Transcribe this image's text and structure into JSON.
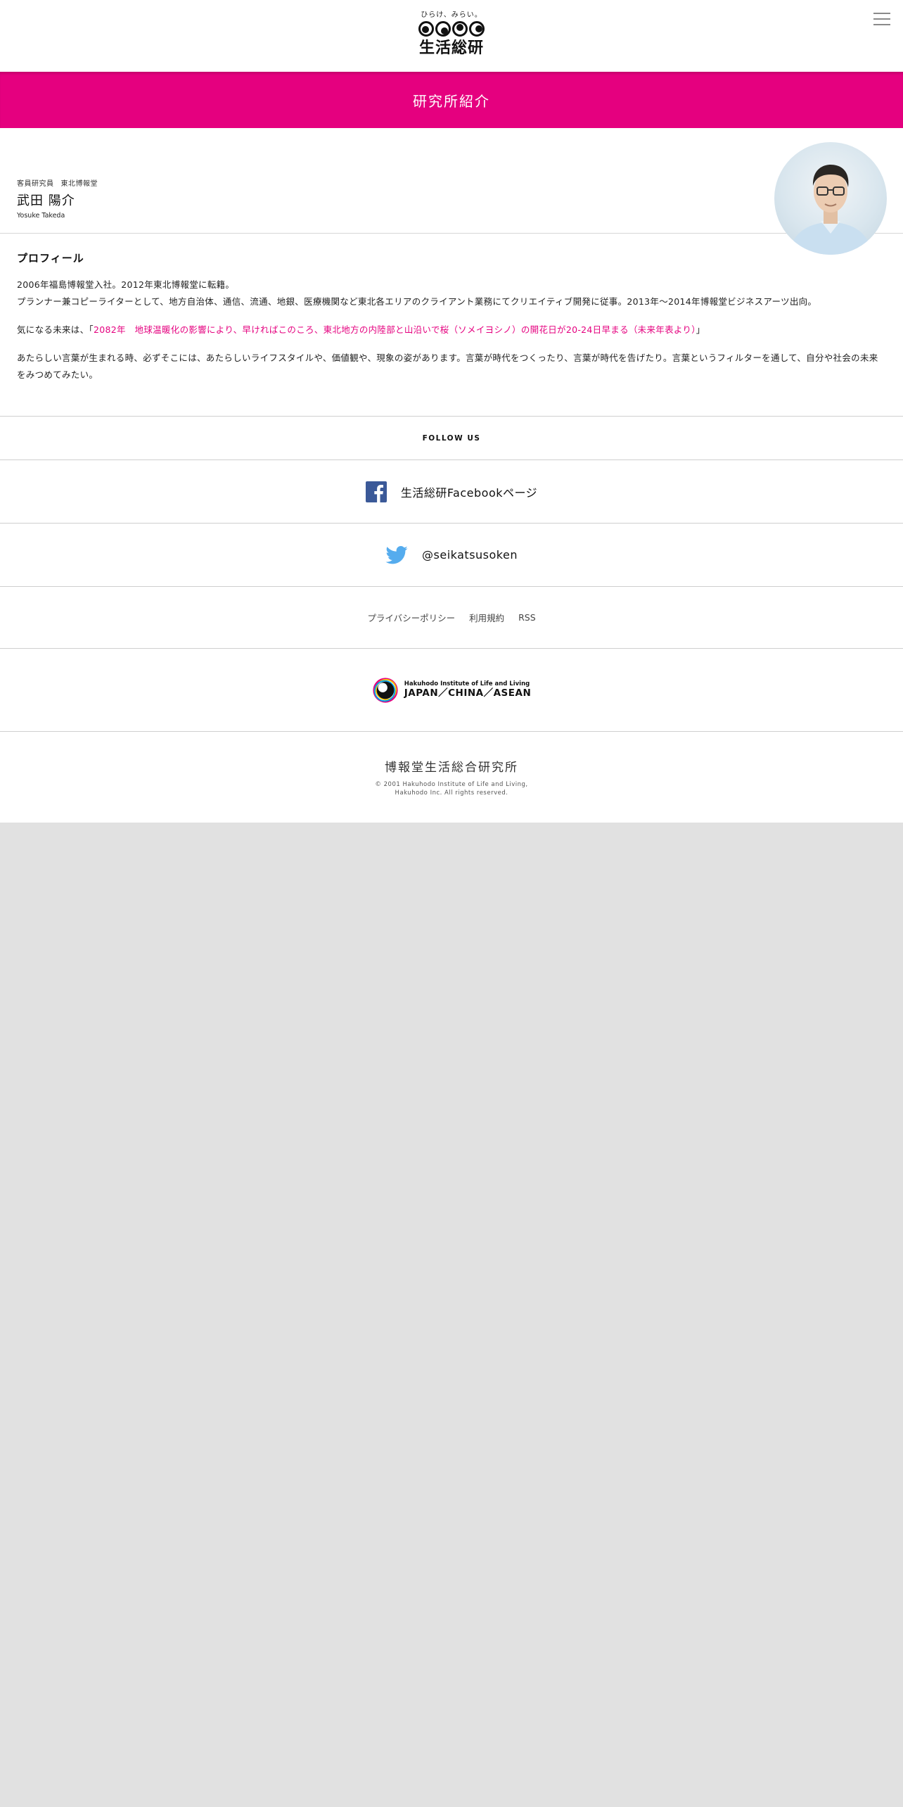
{
  "header": {
    "logo_tagline": "ひらけ、みらい。",
    "logo_name": "生活総研"
  },
  "title_bar": {
    "title": "研究所紹介"
  },
  "profile": {
    "role": "客員研究員",
    "affiliation": "東北博報堂",
    "name": "武田 陽介",
    "romaji": "Yosuke Takeda",
    "section_heading": "プロフィール",
    "bio_line1": "2006年福島博報堂入社。2012年東北博報堂に転籍。",
    "bio_line2": "プランナー兼コピーライターとして、地方自治体、通信、流通、地銀、医療機関など東北各エリアのクライアント業務にてクリエイティブ開発に従事。2013年～2014年博報堂ビジネスアーツ出向。",
    "future_prefix": "気になる未来は、「",
    "future_link": "2082年　地球温暖化の影響により、早ければこのころ、東北地方の内陸部と山沿いで桜（ソメイヨシノ）の開花日が20-24日早まる（未来年表より）",
    "future_suffix": "」",
    "closing": "あたらしい言葉が生まれる時、必ずそこには、あたらしいライフスタイルや、価値観や、現象の姿があります。言葉が時代をつくったり、言葉が時代を告げたり。言葉というフィルターを通して、自分や社会の未来をみつめてみたい。"
  },
  "follow": {
    "heading": "FOLLOW US",
    "facebook_label": "生活総研Facebookページ",
    "twitter_label": "@seikatsusoken"
  },
  "footer_links": [
    "プライバシーポリシー",
    "利用規約",
    "RSS"
  ],
  "brand": {
    "sub": "Hakuhodo Institute of Life and Living",
    "main": "JAPAN／CHINA／ASEAN"
  },
  "corporate": {
    "name": "博報堂生活総合研究所",
    "copyright_line1": "© 2001 Hakuhodo Institute of Life and Living,",
    "copyright_line2": "Hakuhodo Inc. All rights reserved."
  },
  "colors": {
    "accent": "#e5007f",
    "facebook": "#3b5998",
    "twitter": "#55acee",
    "background": "#e1e1e1"
  },
  "icons": [
    "menu-icon",
    "facebook-icon",
    "twitter-icon"
  ]
}
